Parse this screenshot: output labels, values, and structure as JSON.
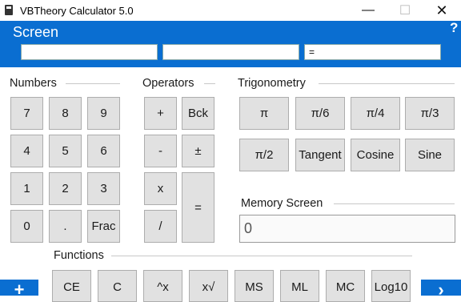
{
  "window": {
    "title": "VBTheory Calculator 5.0",
    "minimize": "—",
    "maximize": "☐",
    "close": "✕"
  },
  "screen": {
    "label": "Screen",
    "help": "?",
    "field1": "",
    "field2": "",
    "field3": "="
  },
  "numbers": {
    "label": "Numbers",
    "keys": [
      "7",
      "8",
      "9",
      "4",
      "5",
      "6",
      "1",
      "2",
      "3",
      "0",
      ".",
      "Frac"
    ]
  },
  "operators": {
    "label": "Operators",
    "keys": [
      "+",
      "Bck",
      "-",
      "±",
      "x",
      "/",
      "="
    ]
  },
  "trigonometry": {
    "label": "Trigonometry",
    "keys": [
      "π",
      "π/6",
      "π/4",
      "π/3",
      "π/2",
      "Tangent",
      "Cosine",
      "Sine"
    ]
  },
  "memory": {
    "label": "Memory Screen",
    "value": "0"
  },
  "functions": {
    "label": "Functions",
    "keys": [
      "CE",
      "C",
      "^x",
      "x√",
      "MS",
      "ML",
      "MC",
      "Log10"
    ]
  },
  "nav": {
    "left": "+",
    "right": "›"
  },
  "colors": {
    "accent": "#0a6ed1",
    "button_face": "#e1e1e1",
    "button_border": "#adadad"
  }
}
